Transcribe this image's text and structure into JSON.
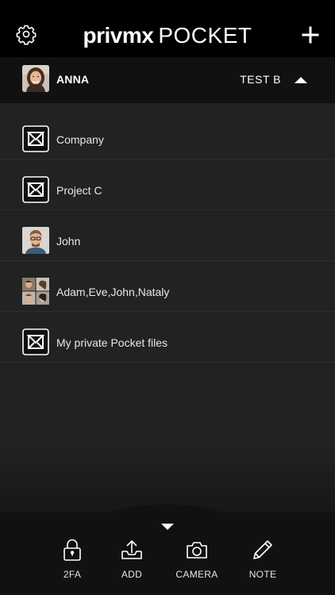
{
  "header": {
    "brand": "privmx",
    "product": "POCKET"
  },
  "account": {
    "name": "ANNA",
    "server": "TEST B"
  },
  "sections": [
    {
      "label": "Company",
      "icon": "section-logo-icon"
    },
    {
      "label": "Project C",
      "icon": "section-logo-icon"
    },
    {
      "label": "John",
      "icon": "user-avatar"
    },
    {
      "label": "Adam,Eve,John,Nataly",
      "icon": "group-avatar"
    },
    {
      "label": "My private Pocket files",
      "icon": "section-logo-icon"
    }
  ],
  "actions": [
    {
      "label": "2FA",
      "icon": "lock-icon"
    },
    {
      "label": "ADD",
      "icon": "upload-icon"
    },
    {
      "label": "CAMERA",
      "icon": "camera-icon"
    },
    {
      "label": "NOTE",
      "icon": "pencil-icon"
    }
  ],
  "colors": {
    "background": "#212222",
    "bar": "#111112",
    "text": "#ffffff"
  }
}
